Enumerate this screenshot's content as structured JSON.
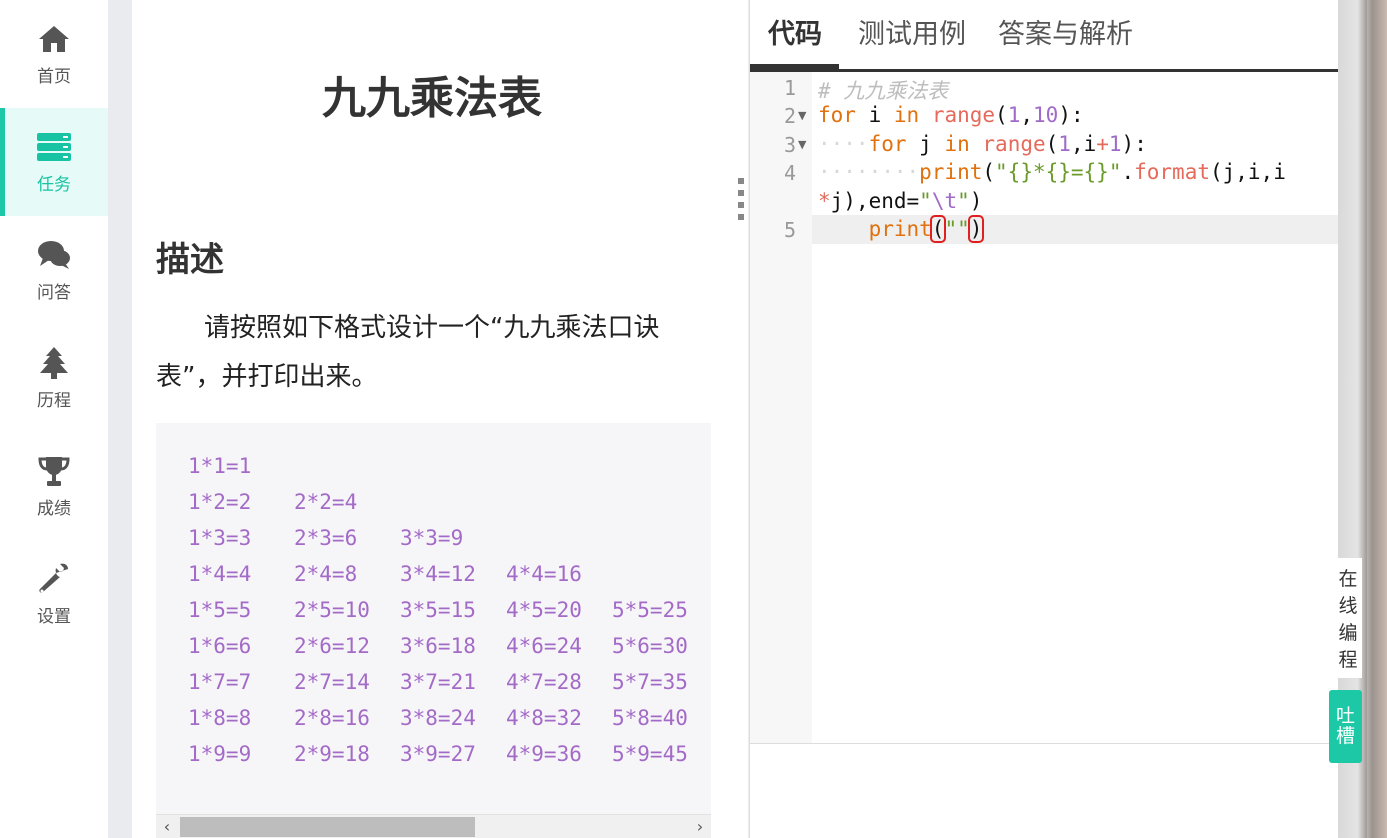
{
  "sidebar": {
    "items": [
      {
        "label": "首页",
        "icon": "home-icon"
      },
      {
        "label": "任务",
        "icon": "task-list-icon",
        "active": true
      },
      {
        "label": "问答",
        "icon": "chat-bubbles-icon"
      },
      {
        "label": "历程",
        "icon": "tree-icon"
      },
      {
        "label": "成绩",
        "icon": "trophy-icon"
      },
      {
        "label": "设置",
        "icon": "wrench-icon"
      }
    ],
    "active_color": "#1cc8a5"
  },
  "problem": {
    "title": "九九乘法表",
    "section_heading": "描述",
    "description": "请按照如下格式设计一个“九九乘法口诀表”，并打印出来。",
    "example_rows": [
      [
        "1*1=1"
      ],
      [
        "1*2=2",
        "2*2=4"
      ],
      [
        "1*3=3",
        "2*3=6",
        "3*3=9"
      ],
      [
        "1*4=4",
        "2*4=8",
        "3*4=12",
        "4*4=16"
      ],
      [
        "1*5=5",
        "2*5=10",
        "3*5=15",
        "4*5=20",
        "5*5=25"
      ],
      [
        "1*6=6",
        "2*6=12",
        "3*6=18",
        "4*6=24",
        "5*6=30"
      ],
      [
        "1*7=7",
        "2*7=14",
        "3*7=21",
        "4*7=28",
        "5*7=35"
      ],
      [
        "1*8=8",
        "2*8=16",
        "3*8=24",
        "4*8=32",
        "5*8=40"
      ],
      [
        "1*9=9",
        "2*9=18",
        "3*9=27",
        "4*9=36",
        "5*9=45"
      ]
    ],
    "scroll_left_icon": "chevron-left-icon",
    "scroll_right_icon": "chevron-right-icon"
  },
  "editor": {
    "tabs": [
      {
        "label": "代码",
        "active": true
      },
      {
        "label": "测试用例"
      },
      {
        "label": "答案与解析"
      }
    ],
    "line_numbers": [
      "1",
      "2",
      "3",
      "4",
      "5"
    ],
    "code": {
      "line1_comment": "# 九九乘法表",
      "line2_for": "for",
      "line2_var": " i ",
      "line2_in": "in",
      "line2_range": "range",
      "line2_open": "(",
      "line2_n1": "1",
      "line2_comma": ",",
      "line2_n2": "10",
      "line2_close": "):",
      "line3_indent": "····",
      "line3_for": "for",
      "line3_var": " j ",
      "line3_in": "in",
      "line3_range": "range",
      "line3_open": "(",
      "line3_n1": "1",
      "line3_mid": ",i",
      "line3_plus": "+",
      "line3_n2": "1",
      "line3_close": "):",
      "line4_indent": "········",
      "line4_print": "print",
      "line4_open": "(",
      "line4_str": "\"{}*{}={}\"",
      "line4_dot": ".",
      "line4_format": "format",
      "line4_args": "(j,i,i",
      "line4b_op": "*",
      "line4b_rest": "j),end=",
      "line4b_str1": "\"",
      "line4b_esc": "\\t",
      "line4b_str2": "\"",
      "line4b_close": ")",
      "line5_indent": "    ",
      "line5_print": "print",
      "line5_open": "(",
      "line5_str": "\"\"",
      "line5_close": ")"
    }
  },
  "floating": {
    "online_coding": [
      "在",
      "线",
      "编",
      "程"
    ],
    "feedback": [
      "吐",
      "槽"
    ]
  }
}
